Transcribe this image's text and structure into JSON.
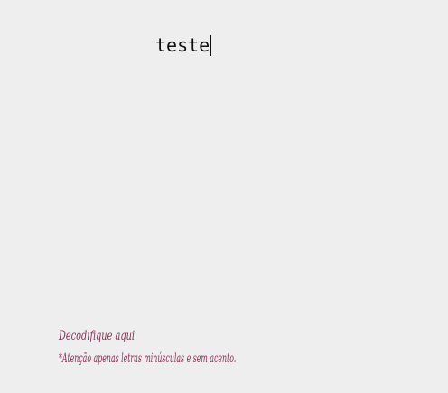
{
  "editor": {
    "value": "teste"
  },
  "footer": {
    "title": "Decodifique aqui",
    "hint": "*Atenção apenas letras minúsculas e sem acento."
  }
}
